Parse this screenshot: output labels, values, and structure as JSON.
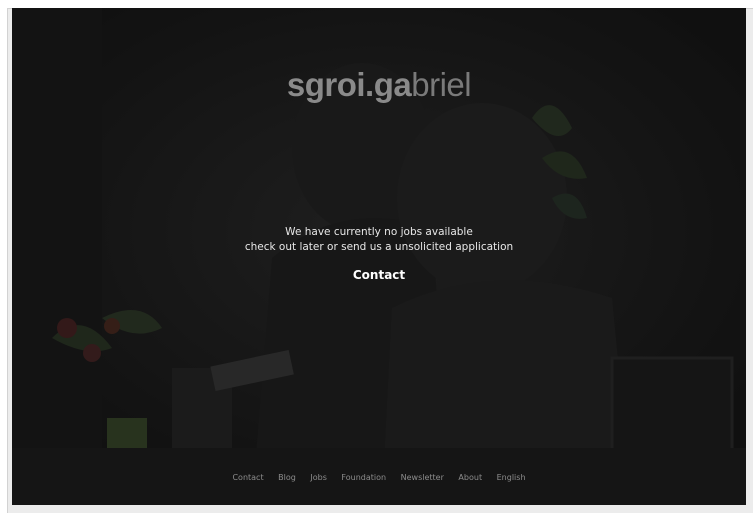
{
  "brand": {
    "part1": "sgroi.",
    "part2": "ga",
    "part3": "briel"
  },
  "message": {
    "line1": "We have currently no jobs available",
    "line2": "check out later or send us a unsolicited application"
  },
  "contact_label": "Contact",
  "footer": {
    "items": [
      "Contact",
      "Blog",
      "Jobs",
      "Foundation",
      "Newsletter",
      "About",
      "English"
    ]
  }
}
